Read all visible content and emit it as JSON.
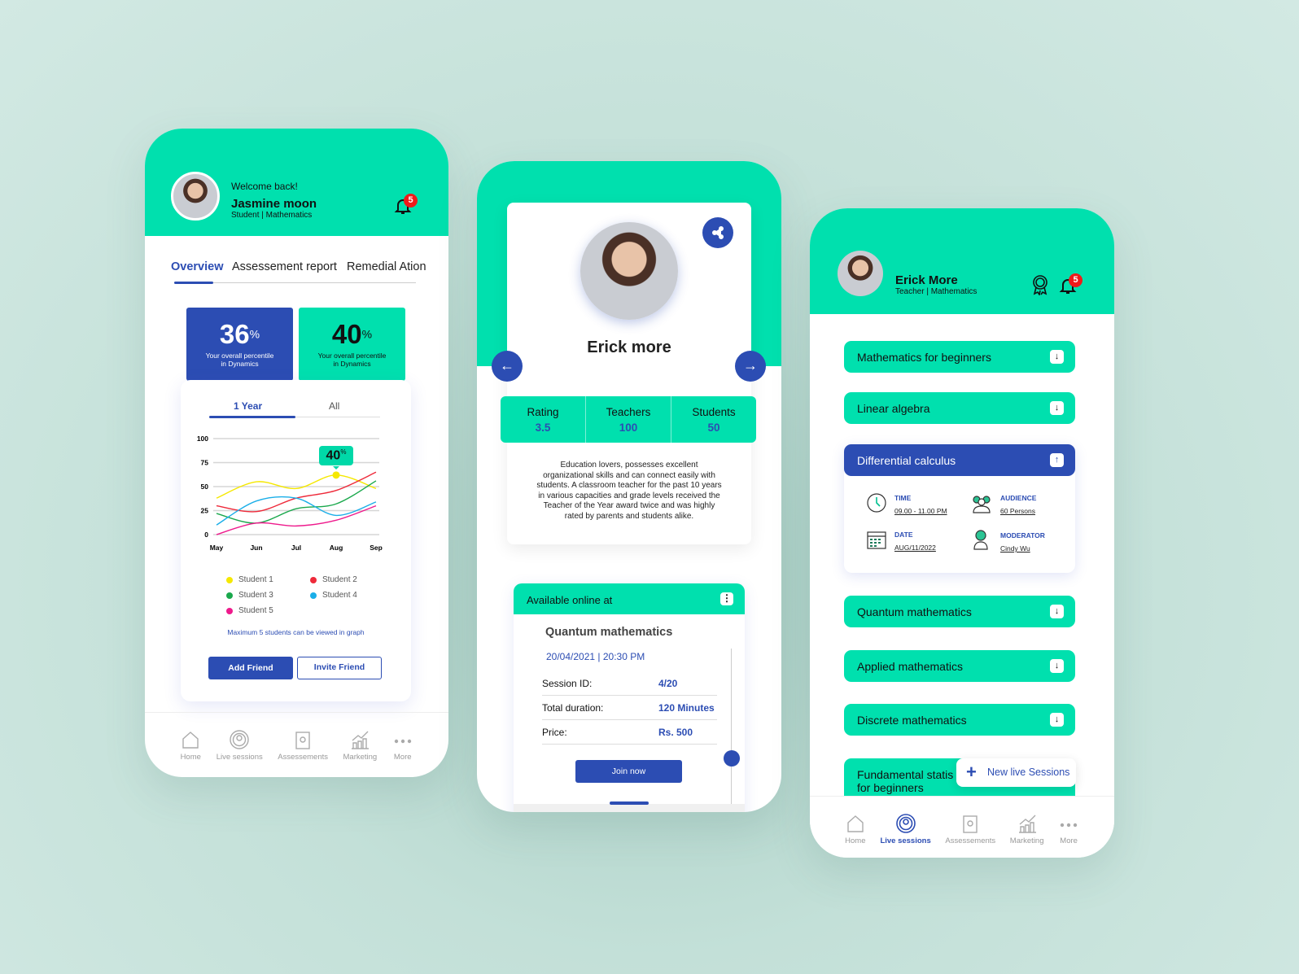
{
  "student_app": {
    "welcome": "Welcome back!",
    "name": "Jasmine moon",
    "role": "Student | Mathematics",
    "notifications": "5",
    "tabs": [
      "Overview",
      "Assessement report",
      "Remedial Ation"
    ],
    "active_tab": "Overview",
    "stats": [
      {
        "value": "36",
        "unit": "%",
        "label1": "Your overall percentile",
        "label2": "in Dynamics"
      },
      {
        "value": "40",
        "unit": "%",
        "label1": "Your overall percentile",
        "label2": "in Dynamics"
      }
    ],
    "range_tabs": [
      "1 Year",
      "All"
    ],
    "active_range": "1 Year",
    "tooltip": {
      "value": "40",
      "unit": "%"
    },
    "note": "Maximum 5 students can be viewed in graph",
    "add_friend": "Add Friend",
    "invite_friend": "Invite Friend",
    "nav": [
      "Home",
      "Live sessions",
      "Assessements",
      "Marketing",
      "More"
    ]
  },
  "chart_data": {
    "type": "line",
    "x": [
      "May",
      "Jun",
      "Jul",
      "Aug",
      "Sep"
    ],
    "ylim": [
      0,
      100
    ],
    "yticks": [
      0,
      25,
      50,
      75,
      100
    ],
    "grid": true,
    "legend": "bottom",
    "series": [
      {
        "name": "Student 1",
        "color": "#f5e800",
        "values": [
          38,
          55,
          48,
          62,
          48
        ]
      },
      {
        "name": "Student 2",
        "color": "#ee2a3a",
        "values": [
          30,
          24,
          38,
          46,
          65
        ]
      },
      {
        "name": "Student 3",
        "color": "#1aa84c",
        "values": [
          22,
          12,
          27,
          32,
          56
        ]
      },
      {
        "name": "Student 4",
        "color": "#1aaee8",
        "values": [
          10,
          35,
          38,
          20,
          34
        ]
      },
      {
        "name": "Student 5",
        "color": "#ee1a8c",
        "values": [
          0,
          12,
          9,
          15,
          30
        ]
      }
    ]
  },
  "teacher_profile": {
    "name": "Erick more",
    "stats": [
      {
        "label": "Rating",
        "value": "3.5"
      },
      {
        "label": "Teachers",
        "value": "100"
      },
      {
        "label": "Students",
        "value": "50"
      }
    ],
    "bio": "Education lovers, possesses excellent organizational skills and can connect easily with students. A classroom teacher for the past 10 years in various capacities and grade levels received the Teacher of the Year award twice and was highly rated by parents and students alike.",
    "available": "Available online at",
    "course": "Quantum mathematics",
    "datetime": "20/04/2021 | 20:30 PM",
    "details": [
      {
        "label": "Session ID:",
        "value": "4/20"
      },
      {
        "label": "Total duration:",
        "value": "120 Minutes"
      },
      {
        "label": "Price:",
        "value": "Rs. 500"
      }
    ],
    "join": "Join now"
  },
  "teacher_app": {
    "name": "Erick More",
    "role": "Teacher | Mathematics",
    "notifications": "5",
    "courses": [
      "Mathematics for beginners",
      "Linear algebra",
      "Differential calculus",
      "Quantum mathematics",
      "Applied mathematics",
      "Discrete mathematics",
      "Fundamental statis",
      "for beginners"
    ],
    "expanded": {
      "time_label": "TIME",
      "time": "09.00 - 11.00 PM",
      "audience_label": "AUDIENCE",
      "audience": "60 Persons",
      "date_label": "DATE",
      "date": "AUG/11/2022",
      "moderator_label": "MODERATOR",
      "moderator": "Cindy Wu"
    },
    "new_session": "New live Sessions",
    "nav": [
      "Home",
      "Live sessions",
      "Assessements",
      "Marketing",
      "More"
    ],
    "active_nav": "Live sessions"
  },
  "colors": {
    "green": "#00e0ae",
    "blue": "#2c4db3",
    "badge": "#f01a1a"
  }
}
